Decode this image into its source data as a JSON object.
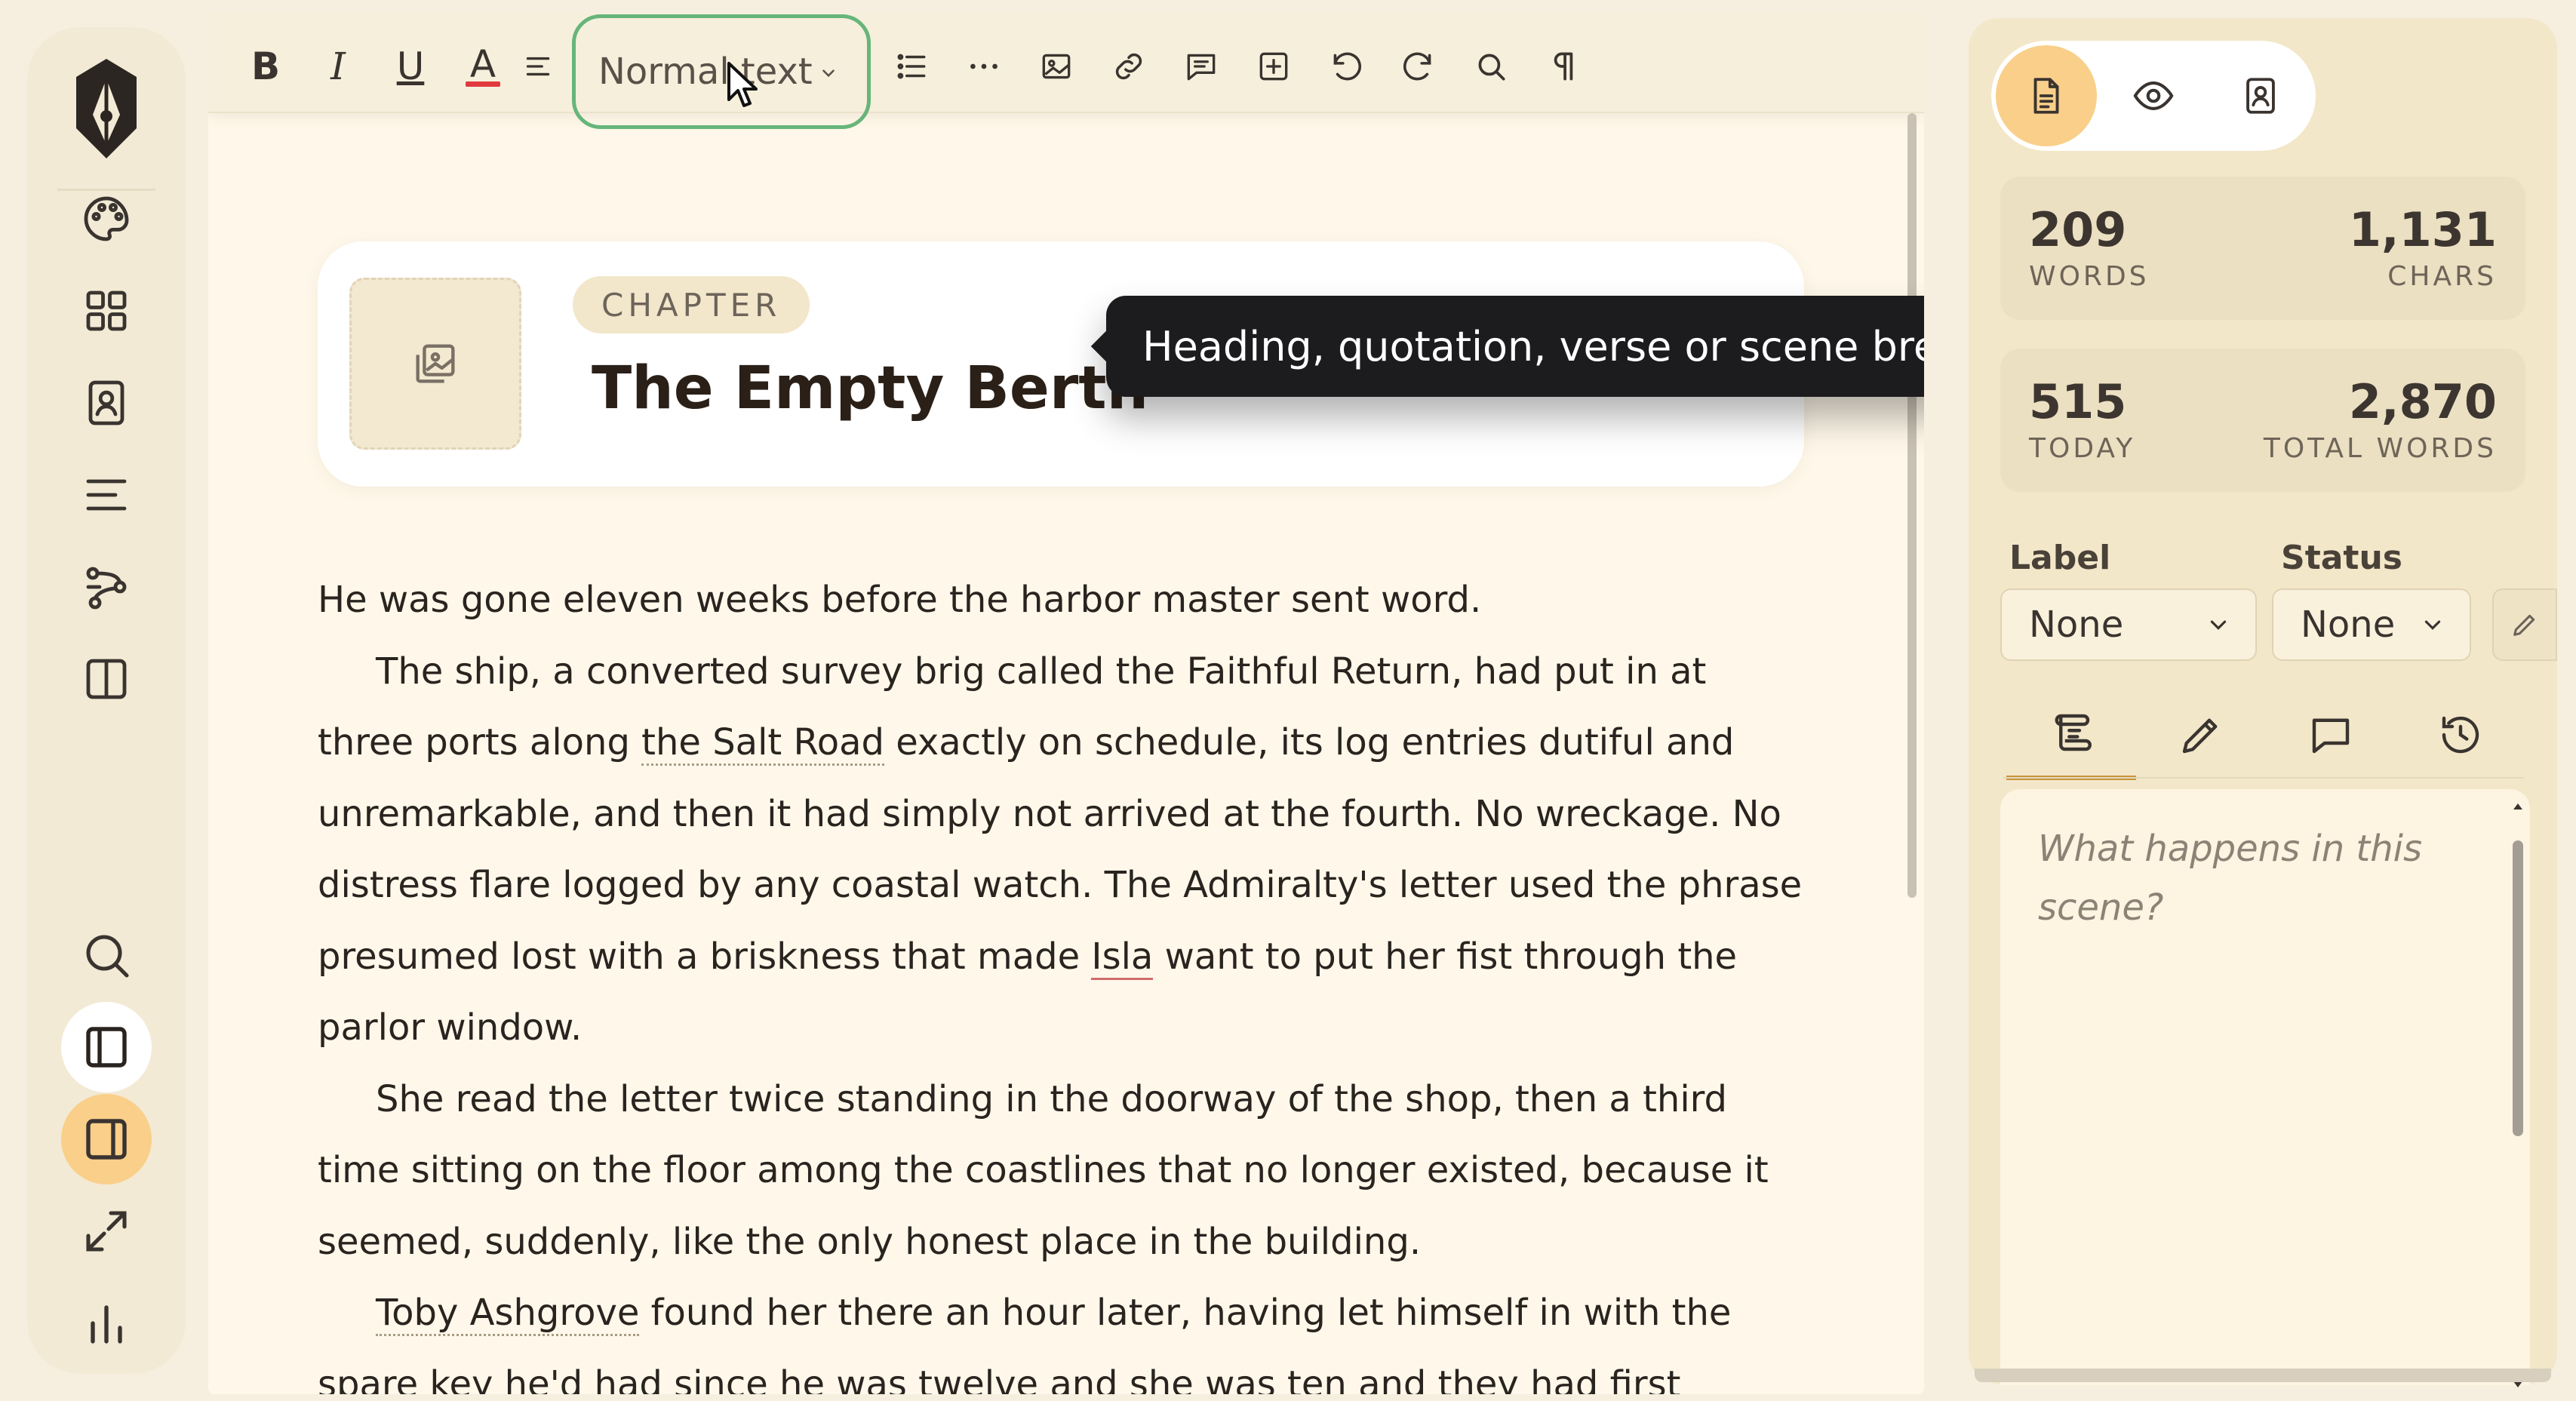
{
  "toolbar": {
    "style_select_value": "Normal text",
    "buttons": [
      "bold",
      "italic",
      "underline",
      "text-color",
      "align",
      "list",
      "more",
      "image",
      "link",
      "comment",
      "insert",
      "undo",
      "redo",
      "find",
      "paragraph-marks"
    ],
    "bold_glyph": "B",
    "italic_glyph": "I",
    "underline_glyph": "U",
    "color_glyph": "A",
    "color_underline": "#e0393e"
  },
  "tooltip": {
    "text": "Heading, quotation, verse or scene break"
  },
  "chapter": {
    "kind": "CHAPTER",
    "title": "The Empty Berth"
  },
  "prose": {
    "p1": "He was gone eleven weeks before the harbor master sent word.",
    "p2_a": "The ship, a converted survey brig called the Faithful Return, had put in at three ports along ",
    "p2_link": "the Salt Road",
    "p2_b": " exactly on schedule, its log entries dutiful and unremarkable, and then it had simply not arrived at the fourth. No wreckage. No distress flare logged by any coastal watch. The Admiralty's letter used the phrase presumed lost with a briskness that made ",
    "p2_name": "Isla",
    "p2_c": " want to put her fist through the parlor window.",
    "p3": "She read the letter twice standing in the doorway of the shop, then a third time sitting on the floor among the coastlines that no longer existed, because it seemed, suddenly, like the only honest place in the building.",
    "p4_name": "Toby Ashgrove",
    "p4_rest": " found her there an hour later, having let himself in with the spare key he'd had since he was twelve and she was ten and they had first"
  },
  "panel": {
    "view_toggle": [
      "document-icon",
      "eye-icon",
      "contact-icon"
    ],
    "stats": {
      "words": "209",
      "words_label": "WORDS",
      "chars": "1,131",
      "chars_label": "CHARS",
      "today": "515",
      "today_label": "TODAY",
      "total_words": "2,870",
      "total_words_label": "TOTAL WORDS"
    },
    "label_title": "Label",
    "label_value": "None",
    "status_title": "Status",
    "status_value": "None",
    "tabs": [
      "synopsis-icon",
      "pencil-icon",
      "comment-icon",
      "history-icon"
    ],
    "synopsis_placeholder": "What happens in this scene?"
  },
  "colors": {
    "accent": "#f9cf8a",
    "focus_ring": "#67b57a",
    "tooltip_bg": "#1c1b1e",
    "page_bg": "#fff8ea",
    "panel_bg": "#f3e7c9"
  }
}
